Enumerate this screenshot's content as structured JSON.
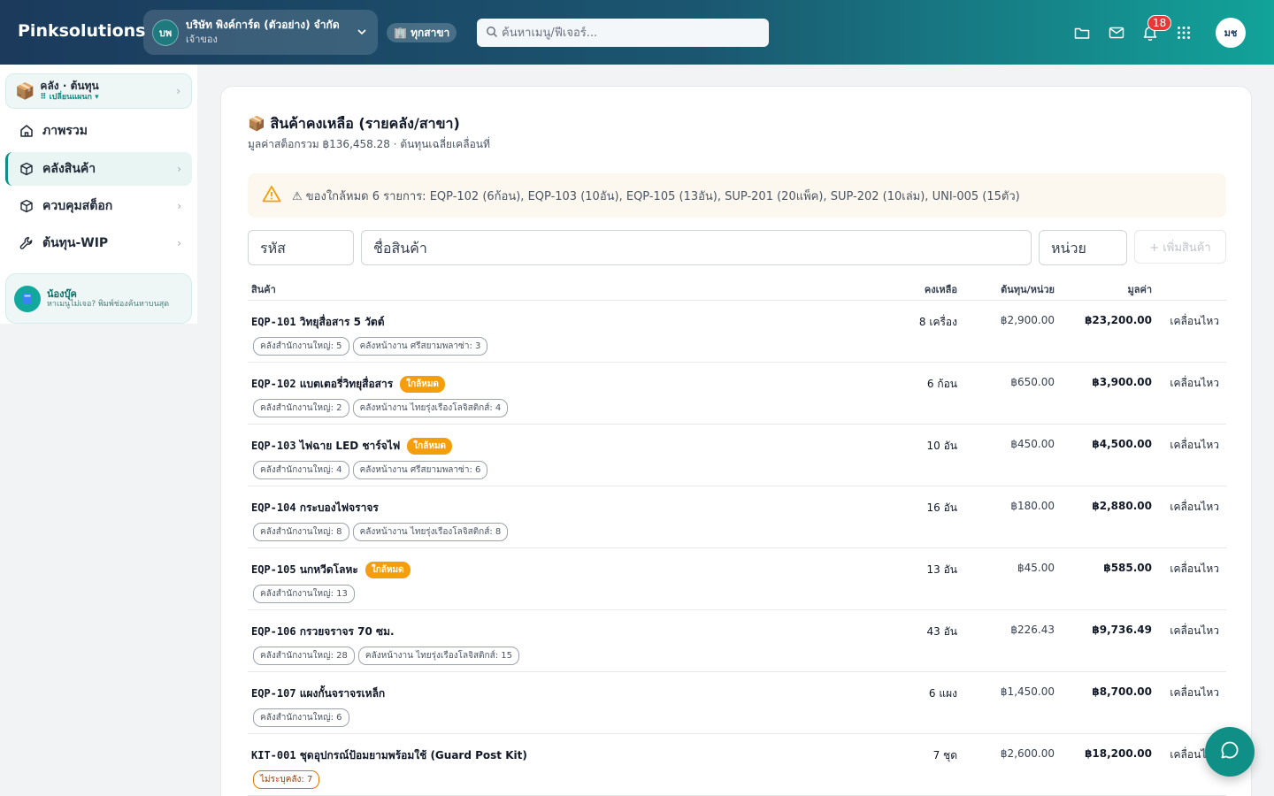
{
  "brand": "Pinksolutions",
  "company": {
    "initials": "บพ",
    "name": "บริษัท พิงค์การ์ด (ตัวอย่าง) จำกัด",
    "role": "เจ้าของ"
  },
  "branch_label": "🏢 ทุกสาขา",
  "search": {
    "placeholder": "ค้นหาเมนู/ฟีเจอร์..."
  },
  "notifications_count": "18",
  "user_initials": "มช",
  "sidebar": {
    "switch_title": "คลัง · ต้นทุน",
    "switch_sub": "⠿ เปลี่ยนแผนก ▾",
    "items": [
      {
        "label": "ภาพรวม",
        "icon": "home-icon"
      },
      {
        "label": "คลังสินค้า",
        "icon": "box-icon"
      },
      {
        "label": "ควบคุมสต็อก",
        "icon": "box-icon"
      },
      {
        "label": "ต้นทุน-WIP",
        "icon": "wrench-icon"
      }
    ],
    "helper_title": "น้องบุ๊ค",
    "helper_text": "หาเมนูไม่เจอ? พิมพ์ช่องค้นหาบนสุด"
  },
  "main": {
    "title": "📦 สินค้าคงเหลือ (รายคลัง/สาขา)",
    "subtitle": "มูลค่าสต็อกรวม ฿136,458.28 · ต้นทุนเฉลี่ยเคลื่อนที่",
    "alert": "⚠ ของใกล้หมด 6 รายการ: EQP-102 (6ก้อน), EQP-103 (10อัน), EQP-105 (13อัน), SUP-201 (20แพ็ค), SUP-202 (10เล่ม), UNI-005 (15ตัว)",
    "form": {
      "code_placeholder": "รหัส",
      "name_placeholder": "ชื่อสินค้า",
      "unit_placeholder": "หน่วย",
      "add_label": "+ เพิ่มสินค้า"
    },
    "columns": {
      "product": "สินค้า",
      "qty": "คงเหลือ",
      "cost": "ต้นทุน/หน่วย",
      "value": "มูลค่า"
    },
    "low_label": "ใกล้หมด",
    "move_label": "เคลื่อนไหว",
    "rows": [
      {
        "code": "EQP-101",
        "name": "วิทยุสื่อสาร 5 วัตต์",
        "low": false,
        "qty": "8 เครื่อง",
        "cost": "฿2,900.00",
        "value": "฿23,200.00",
        "chips": [
          "คลังสำนักงานใหญ่: 5",
          "คลังหน้างาน ศรีสยามพลาซ่า: 3"
        ]
      },
      {
        "code": "EQP-102",
        "name": "แบตเตอรี่วิทยุสื่อสาร",
        "low": true,
        "qty": "6 ก้อน",
        "cost": "฿650.00",
        "value": "฿3,900.00",
        "chips": [
          "คลังสำนักงานใหญ่: 2",
          "คลังหน้างาน ไทยรุ่งเรืองโลจิสติกส์: 4"
        ]
      },
      {
        "code": "EQP-103",
        "name": "ไฟฉาย LED ชาร์จไฟ",
        "low": true,
        "qty": "10 อัน",
        "cost": "฿450.00",
        "value": "฿4,500.00",
        "chips": [
          "คลังสำนักงานใหญ่: 4",
          "คลังหน้างาน ศรีสยามพลาซ่า: 6"
        ]
      },
      {
        "code": "EQP-104",
        "name": "กระบองไฟจราจร",
        "low": false,
        "qty": "16 อัน",
        "cost": "฿180.00",
        "value": "฿2,880.00",
        "chips": [
          "คลังสำนักงานใหญ่: 8",
          "คลังหน้างาน ไทยรุ่งเรืองโลจิสติกส์: 8"
        ]
      },
      {
        "code": "EQP-105",
        "name": "นกหวีดโลหะ",
        "low": true,
        "qty": "13 อัน",
        "cost": "฿45.00",
        "value": "฿585.00",
        "chips": [
          "คลังสำนักงานใหญ่: 13"
        ]
      },
      {
        "code": "EQP-106",
        "name": "กรวยจราจร 70 ซม.",
        "low": false,
        "qty": "43 อัน",
        "cost": "฿226.43",
        "value": "฿9,736.49",
        "chips": [
          "คลังสำนักงานใหญ่: 28",
          "คลังหน้างาน ไทยรุ่งเรืองโลจิสติกส์: 15"
        ]
      },
      {
        "code": "EQP-107",
        "name": "แผงกั้นจราจรเหล็ก",
        "low": false,
        "qty": "6 แผง",
        "cost": "฿1,450.00",
        "value": "฿8,700.00",
        "chips": [
          "คลังสำนักงานใหญ่: 6"
        ]
      },
      {
        "code": "KIT-001",
        "name": "ชุดอุปกรณ์ป้อมยามพร้อมใช้ (Guard Post Kit)",
        "low": false,
        "qty": "7 ชุด",
        "cost": "฿2,600.00",
        "value": "฿18,200.00",
        "chips": [
          "ไม่ระบุคลัง: 7"
        ],
        "chip_warn": true
      }
    ]
  },
  "colors": {
    "accent": "#0f8f86",
    "warning": "#f59e0b",
    "danger": "#e53935"
  }
}
